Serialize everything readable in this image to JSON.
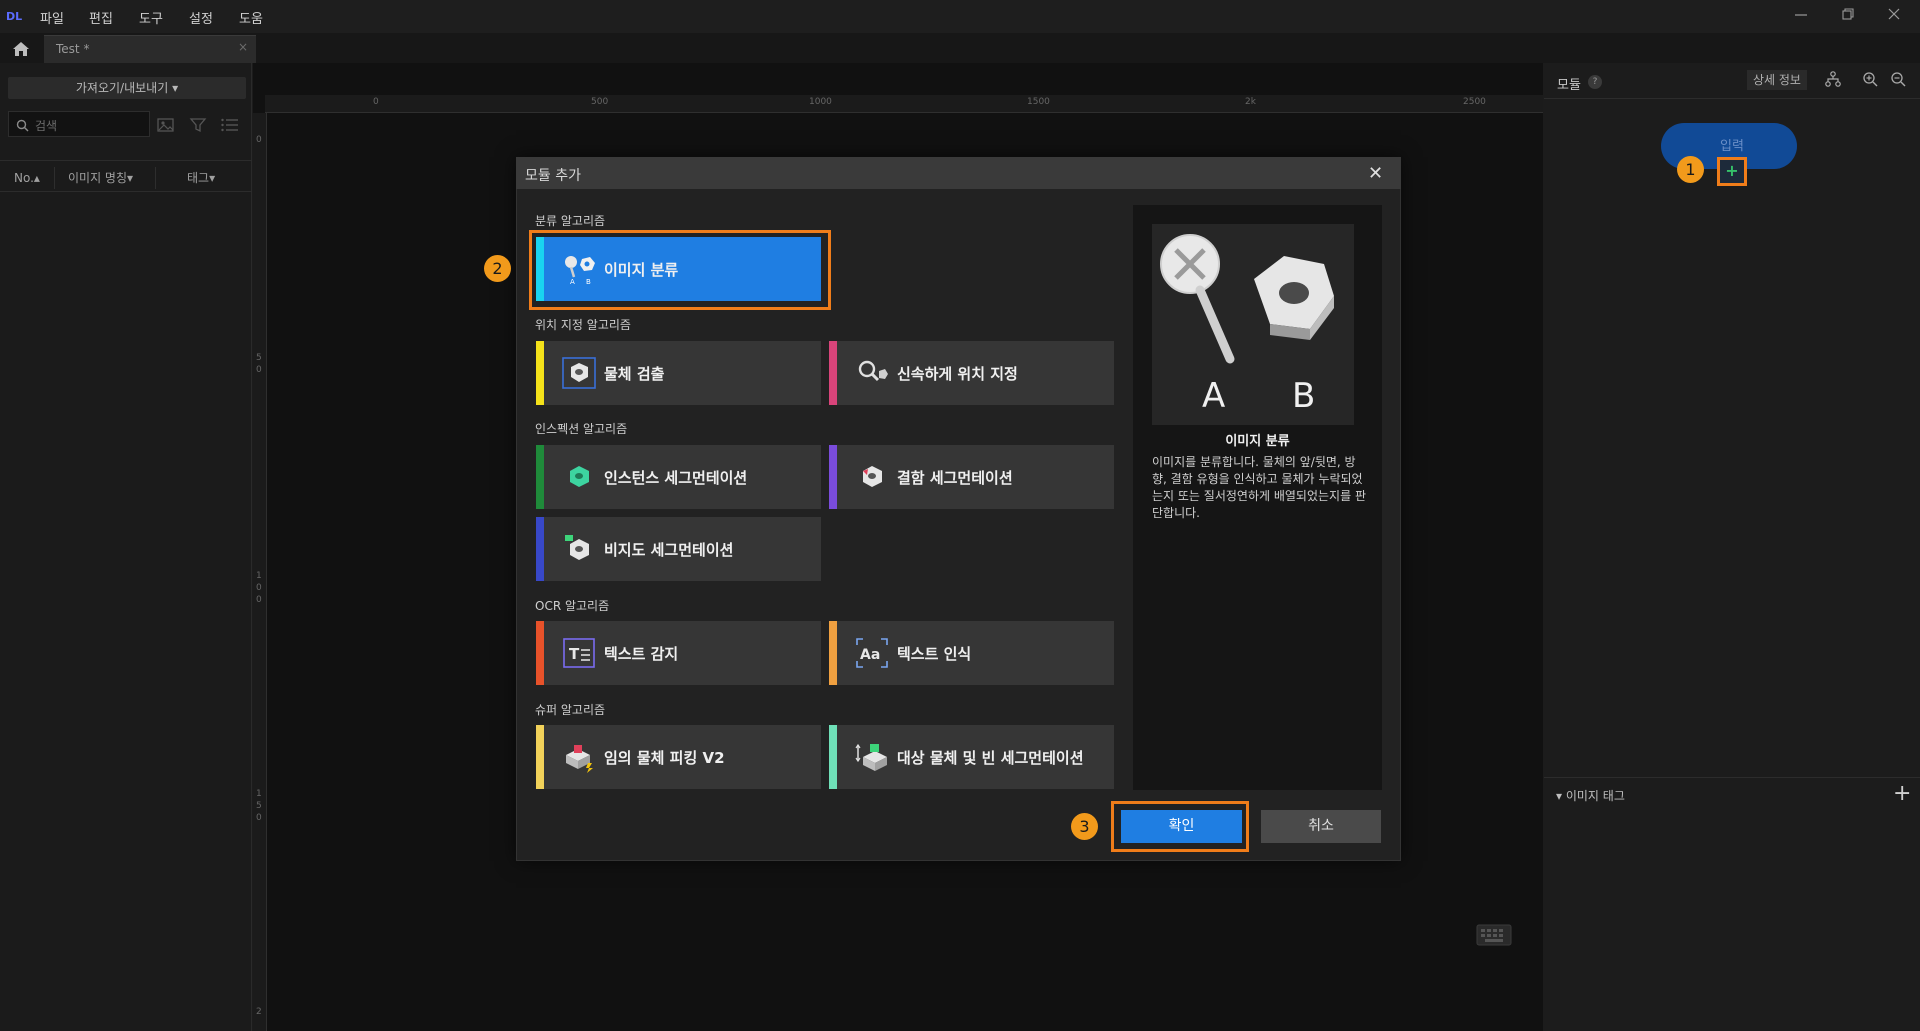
{
  "menu": {
    "items": [
      "파일",
      "편집",
      "도구",
      "설정",
      "도움"
    ]
  },
  "tab": {
    "title": "Test *",
    "close": "×"
  },
  "left_panel": {
    "import_export": "가져오기/내보내기 ▾",
    "search_placeholder": "검색",
    "columns": [
      "No.▴",
      "이미지 명칭▾",
      "태그▾"
    ]
  },
  "ruler": {
    "top": [
      "0",
      "500",
      "1000",
      "1500",
      "2k",
      "2500"
    ],
    "left": [
      "0",
      "5",
      "0",
      "1",
      "0",
      "0",
      "1",
      "5",
      "0",
      "2"
    ]
  },
  "right_panel": {
    "module_label": "모듈",
    "help": "?",
    "detail_button": "상세 정보",
    "input_node": "입력",
    "add_port": "+",
    "tag_header": "▾ 이미지 태그",
    "tag_add": "+"
  },
  "steps": [
    "1",
    "2",
    "3"
  ],
  "dialog": {
    "title": "모듈 추가",
    "close": "✕",
    "categories": {
      "classification": "분류 알고리즘",
      "localization": "위치 지정 알고리즘",
      "inspection": "인스펙션 알고리즘",
      "ocr": "OCR 알고리즘",
      "super": "슈퍼 알고리즘"
    },
    "algorithms": {
      "image_classification": "이미지 분류",
      "object_detection": "물체 검출",
      "fast_positioning": "신속하게 위치 지정",
      "instance_segmentation": "인스턴스 세그먼테이션",
      "defect_segmentation": "결함 세그먼테이션",
      "unsupervised_segmentation": "비지도 세그먼테이션",
      "text_detection": "텍스트 감지",
      "text_recognition": "텍스트 인식",
      "arbitrary_picking": "임의 물체 피킹 V2",
      "object_bin_segmentation": "대상 물체 및 빈 세그먼테이션"
    },
    "preview": {
      "label_a": "A",
      "label_b": "B",
      "title": "이미지 분류",
      "description": "이미지를 분류합니다. 물체의 앞/뒷면, 방향, 결함 유형을 인식하고 물체가 누락되었는지 또는 질서정연하게 배열되었는지를 판단합니다."
    },
    "ok": "확인",
    "cancel": "취소"
  },
  "colors": {
    "accent_blue": "#1f7ee2",
    "highlight_orange": "#f07d1a",
    "badge_orange": "#f29a1b",
    "stripe_cyan": "#19d3f0",
    "stripe_yellow": "#f5e21a",
    "stripe_pink": "#d9447a",
    "stripe_green": "#1f8a3a",
    "stripe_purple": "#7a4cdb",
    "stripe_blue": "#3848c8",
    "stripe_red": "#e8522a",
    "stripe_orange": "#f0a040",
    "stripe_lightyellow": "#f2d25a",
    "stripe_mint": "#6fe0b8"
  }
}
